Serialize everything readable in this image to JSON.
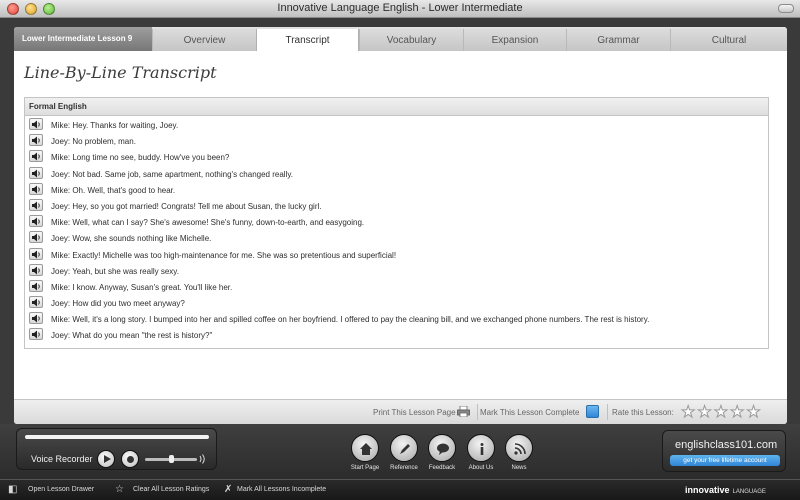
{
  "window": {
    "title": "Innovative Language English - Lower Intermediate"
  },
  "tabs": {
    "lesson_label": "Lower Intermediate Lesson 9",
    "items": [
      "Overview",
      "Transcript",
      "Vocabulary",
      "Expansion",
      "Grammar",
      "Cultural"
    ],
    "active": "Transcript"
  },
  "page": {
    "title": "Line-By-Line Transcript",
    "section_header": "Formal English"
  },
  "transcript": [
    "Mike: Hey. Thanks for waiting, Joey.",
    "Joey: No problem, man.",
    "Mike: Long time no see, buddy. How've you been?",
    "Joey: Not bad. Same job, same apartment, nothing's changed really.",
    "Mike: Oh. Well, that's good to hear.",
    "Joey: Hey, so you got married! Congrats! Tell me about Susan, the lucky girl.",
    "Mike: Well, what can I say? She's awesome! She's funny, down-to-earth, and easygoing.",
    "Joey: Wow, she sounds nothing like Michelle.",
    "Mike: Exactly! Michelle was too high-maintenance for me. She was so pretentious and superficial!",
    "Joey: Yeah, but she was really sexy.",
    "Mike: I know. Anyway, Susan's great. You'll like her.",
    "Joey: How did you two meet anyway?",
    "Mike: Well, it's a long story. I bumped into her and spilled coffee on her boyfriend. I offered to pay the cleaning bill, and we exchanged phone numbers. The rest is history.",
    "Joey: What do you mean \"the rest is history?\""
  ],
  "footer": {
    "print_label": "Print This Lesson Page",
    "complete_label": "Mark This Lesson Complete",
    "rate_label": "Rate this Lesson:",
    "rating": 0,
    "max_rating": 5
  },
  "recorder": {
    "label": "Voice Recorder"
  },
  "nav": [
    "Start Page",
    "Reference",
    "Feedback",
    "About Us",
    "News"
  ],
  "brand": {
    "name": "englishclass101.com",
    "cta": "get your free lifetime account"
  },
  "bottom": {
    "open_drawer": "Open Lesson Drawer",
    "clear_ratings": "Clear All Lesson Ratings",
    "mark_incomplete": "Mark All Lessons Incomplete",
    "logo": "innovative",
    "logo_sub": "LANGUAGE"
  },
  "colors": {
    "accent_blue": "#2f86d6",
    "dark_bg": "#3a3a3a"
  }
}
